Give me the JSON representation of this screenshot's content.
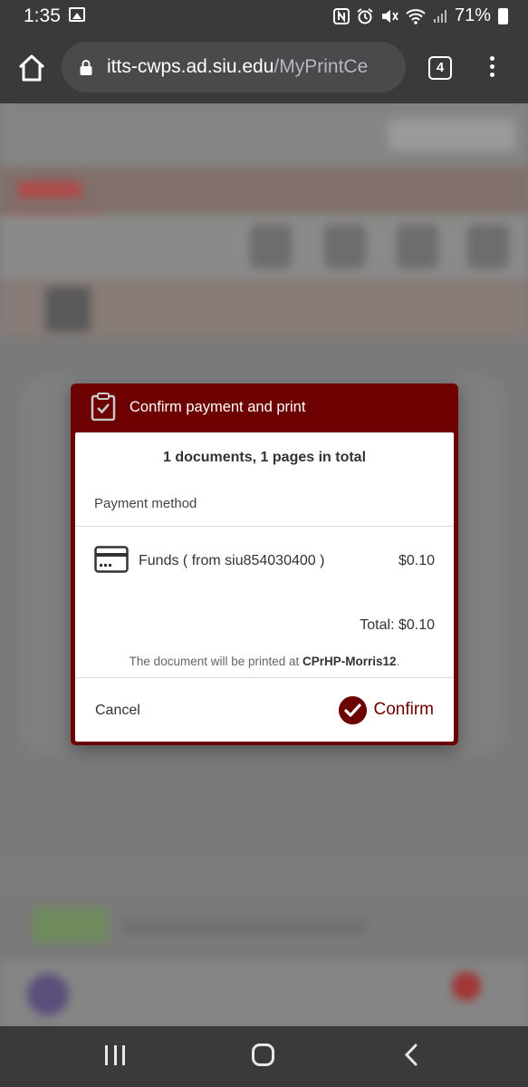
{
  "status_bar": {
    "time": "1:35",
    "battery": "71%",
    "icons": [
      "gallery-icon",
      "nfc-icon",
      "alarm-icon",
      "mute-icon",
      "wifi-icon",
      "signal-icon",
      "battery-icon"
    ]
  },
  "browser": {
    "url_host": "itts-cwps.ad.siu.edu",
    "url_path": "/MyPrintCe",
    "tab_count": "4"
  },
  "dialog": {
    "title": "Confirm payment and print",
    "summary": "1 documents, 1 pages in total",
    "payment_method_label": "Payment method",
    "payment_option": {
      "name": "Funds ( from siu854030400 )",
      "amount": "$0.10"
    },
    "total": "Total: $0.10",
    "printer_note_prefix": "The document will be printed at ",
    "printer_name": "CPrHP-Morris12",
    "printer_note_suffix": ".",
    "cancel_label": "Cancel",
    "confirm_label": "Confirm"
  },
  "colors": {
    "accent": "#6d0000",
    "system_bar": "#3a3a3c"
  }
}
